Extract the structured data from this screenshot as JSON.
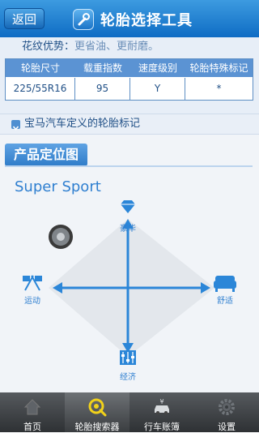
{
  "header": {
    "back_label": "返回",
    "title": "轮胎选择工具"
  },
  "tire": {
    "feature_label": "花纹优势：",
    "feature_value": "更省油、更耐磨。",
    "columns": [
      "轮胎尺寸",
      "载重指数",
      "速度级别",
      "轮胎特殊标记"
    ],
    "row": [
      "225/55R16",
      "95",
      "Y",
      "*"
    ]
  },
  "bmw_mark_link": "宝马汽车定义的轮胎标记",
  "positioning": {
    "section_title": "产品定位图",
    "product_name": "Super Sport",
    "axis_top": "豪华",
    "axis_bottom": "经济",
    "axis_left": "运动",
    "axis_right": "舒适"
  },
  "nav": {
    "items": [
      {
        "label": "首页",
        "icon": "home-icon"
      },
      {
        "label": "轮胎搜索器",
        "icon": "tire-search-icon"
      },
      {
        "label": "行车账簿",
        "icon": "car-ledger-icon"
      },
      {
        "label": "设置",
        "icon": "gear-icon"
      }
    ],
    "active_index": 1
  },
  "colors": {
    "header": "#1a75c9",
    "accent": "#2f7fd0",
    "nav_bg": "#3a3d40",
    "active_icon": "#f2d21a"
  }
}
